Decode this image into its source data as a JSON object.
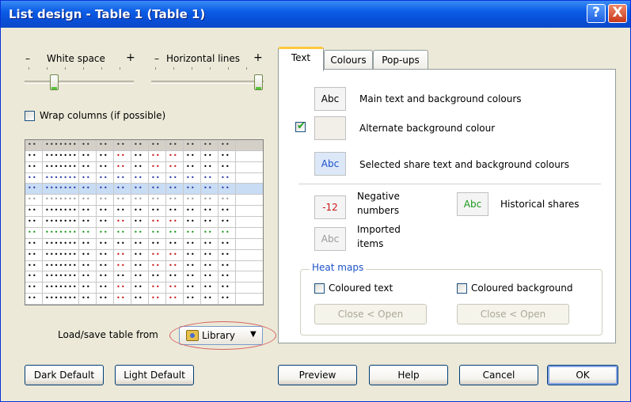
{
  "window": {
    "title": "List design - Table 1 (Table 1)",
    "help_btn": "?",
    "close_btn": "X"
  },
  "sliders": {
    "white_space": {
      "minus": "–",
      "label": "White space",
      "plus": "+",
      "level": 0.25
    },
    "horizontal_lines": {
      "minus": "–",
      "label": "Horizontal lines",
      "plus": "+",
      "level": 1.0
    }
  },
  "wrap_columns": {
    "label": "Wrap columns (if possible)",
    "checked": false
  },
  "preview_grid": {
    "cell_text": "••",
    "wide_cell_text": "•••••••",
    "row_styles": [
      "head",
      "normal",
      "normal",
      "blue",
      "selected",
      "gray",
      "normal",
      "normal",
      "green",
      "normal",
      "normal",
      "normal",
      "normal",
      "normal",
      "normal"
    ]
  },
  "load_save": {
    "label": "Load/save table from",
    "library_label": "Library",
    "arrow": "▼"
  },
  "bottom_buttons": {
    "dark_default": "Dark Default",
    "light_default": "Light Default",
    "preview": "Preview",
    "help": "Help",
    "cancel": "Cancel",
    "ok": "OK"
  },
  "tabs": [
    "Text",
    "Colours",
    "Pop-ups"
  ],
  "text_tab": {
    "main_swatch": "Abc",
    "main_label": "Main text and background colours",
    "alternate_checked": true,
    "alternate_label": "Alternate background colour",
    "selected_swatch": "Abc",
    "selected_label": "Selected share text and background colours",
    "negative_swatch": "-12",
    "negative_label_1": "Negative",
    "negative_label_2": "numbers",
    "historical_swatch": "Abc",
    "historical_label": "Historical shares",
    "imported_swatch": "Abc",
    "imported_label_1": "Imported",
    "imported_label_2": "items"
  },
  "heat_maps": {
    "title": "Heat maps",
    "coloured_text": "Coloured text",
    "coloured_background": "Coloured background",
    "text_btn": "Close < Open",
    "bg_btn": "Close < Open"
  },
  "colors": {
    "title_bar": "#0b5ce6",
    "negative_red": "#c81818",
    "historical_green": "#1a9a1a",
    "selected_blue": "#1c50c8",
    "heat_title": "#1c50c8"
  }
}
